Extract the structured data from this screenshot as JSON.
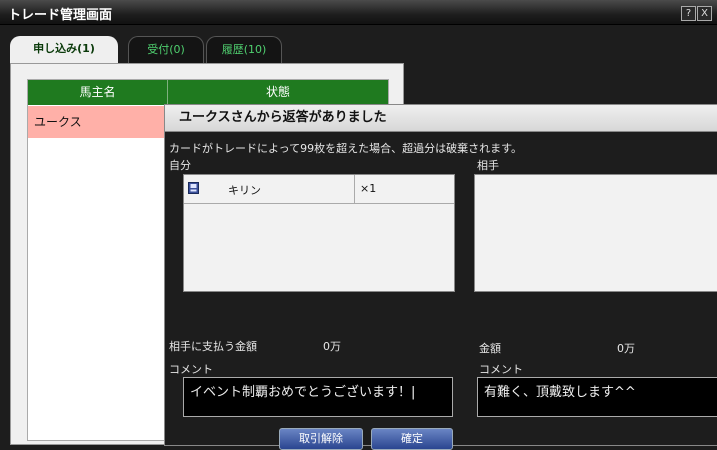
{
  "window": {
    "title": "トレード管理画面",
    "help_label": "?",
    "close_label": "X"
  },
  "tabs": [
    {
      "label": "申し込み(1)"
    },
    {
      "label": "受付(0)"
    },
    {
      "label": "履歴(10)"
    }
  ],
  "table": {
    "headers": [
      "馬主名",
      "状態"
    ],
    "rows": [
      {
        "name": "ユークス"
      }
    ]
  },
  "dialog": {
    "title": "ユークスさんから返答がありました",
    "notice": "カードがトレードによって99枚を超えた場合、超過分は破棄されます。",
    "mine": {
      "label": "自分",
      "items": [
        {
          "icon": "card-icon",
          "name": "キリン",
          "qty": "×1"
        }
      ],
      "pay_label": "相手に支払う金額",
      "pay_value": "0万",
      "comment_label": "コメント",
      "comment": "イベント制覇おめでとうございます！"
    },
    "partner": {
      "label": "相手",
      "amount_label": "金額",
      "amount_value": "0万",
      "comment_label": "コメント",
      "comment": "有難く、頂戴致します^^"
    },
    "buttons": {
      "cancel": "取引解除",
      "confirm": "確定"
    }
  }
}
